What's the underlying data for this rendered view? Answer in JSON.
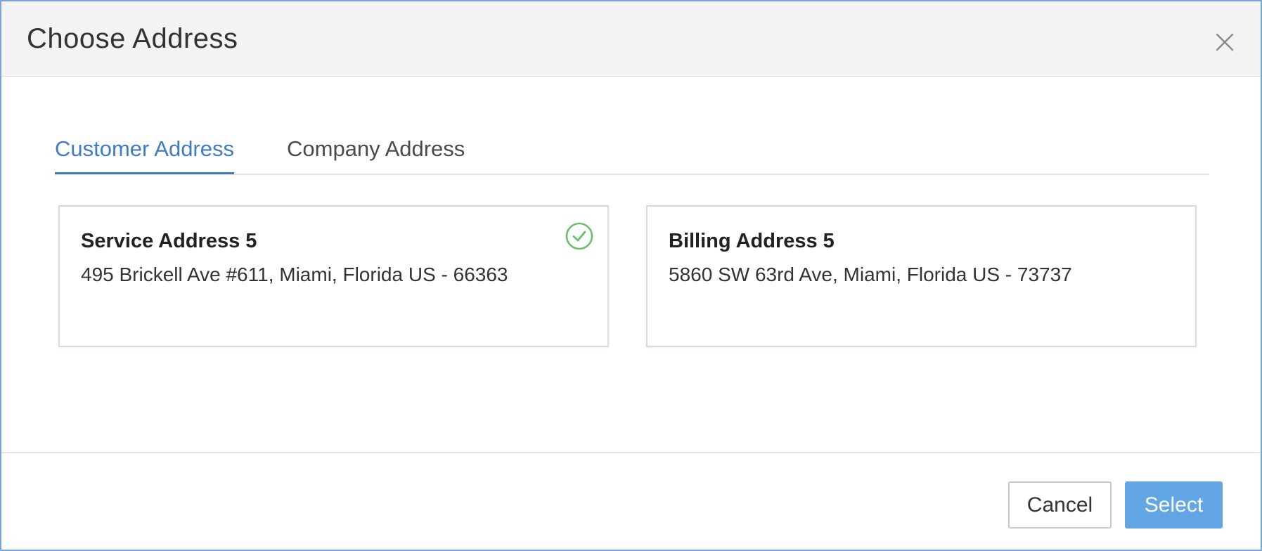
{
  "dialog": {
    "title": "Choose Address"
  },
  "tabs": [
    {
      "label": "Customer Address",
      "active": true
    },
    {
      "label": "Company Address",
      "active": false
    }
  ],
  "addresses": [
    {
      "title": "Service Address 5",
      "text": "495 Brickell Ave #611, Miami, Florida US - 66363",
      "selected": true
    },
    {
      "title": "Billing Address 5",
      "text": "5860 SW 63rd Ave, Miami, Florida US - 73737",
      "selected": false
    }
  ],
  "footer": {
    "cancel_label": "Cancel",
    "select_label": "Select"
  },
  "icons": {
    "close": "close-icon",
    "selected": "check-circle-icon"
  },
  "colors": {
    "accent": "#3f7cc4",
    "primary_button": "#62a6e6",
    "check": "#6cbf6a",
    "header_bg": "#f3f3f3"
  }
}
